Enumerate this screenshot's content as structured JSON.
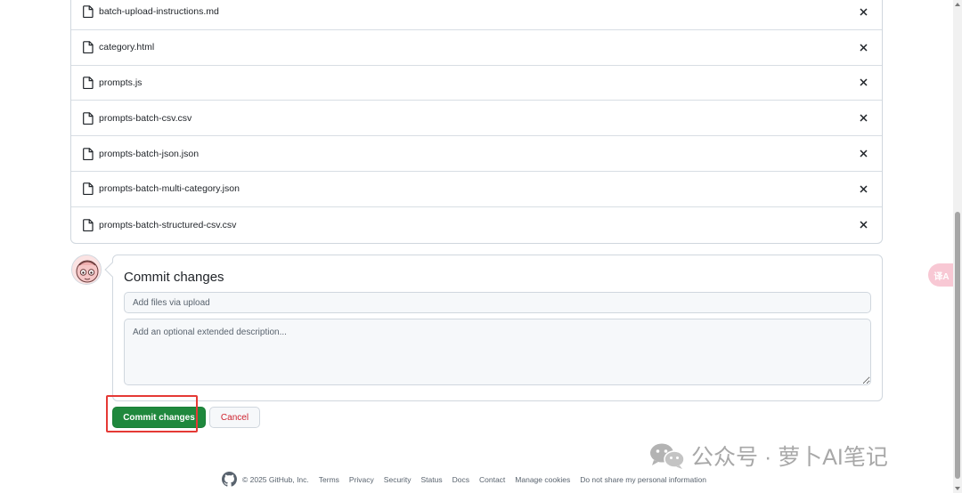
{
  "files": [
    {
      "name": "batch-upload-instructions.md",
      "icon": "file-icon",
      "remove_icon": "close-icon"
    },
    {
      "name": "category.html",
      "icon": "file-icon",
      "remove_icon": "close-icon"
    },
    {
      "name": "prompts.js",
      "icon": "file-icon",
      "remove_icon": "close-icon"
    },
    {
      "name": "prompts-batch-csv.csv",
      "icon": "file-icon",
      "remove_icon": "close-icon"
    },
    {
      "name": "prompts-batch-json.json",
      "icon": "file-icon",
      "remove_icon": "close-icon"
    },
    {
      "name": "prompts-batch-multi-category.json",
      "icon": "file-icon",
      "remove_icon": "close-icon"
    },
    {
      "name": "prompts-batch-structured-csv.csv",
      "icon": "file-icon",
      "remove_icon": "close-icon"
    }
  ],
  "commit": {
    "title": "Commit changes",
    "summary_placeholder": "Add files via upload",
    "description_placeholder": "Add an optional extended description...",
    "commit_label": "Commit changes",
    "cancel_label": "Cancel"
  },
  "watermark": {
    "text": "公众号 · 萝卜AI笔记",
    "icon": "wechat-icon"
  },
  "footer": {
    "copyright": "© 2025 GitHub, Inc.",
    "links": [
      "Terms",
      "Privacy",
      "Security",
      "Status",
      "Docs",
      "Contact",
      "Manage cookies",
      "Do not share my personal information"
    ]
  },
  "translate_button": {
    "label": "译A",
    "icon": "translate-icon"
  },
  "colors": {
    "primary_button": "#1f883d",
    "cancel_text": "#cf222e",
    "highlight": "#e53935",
    "border": "#d0d7de"
  }
}
